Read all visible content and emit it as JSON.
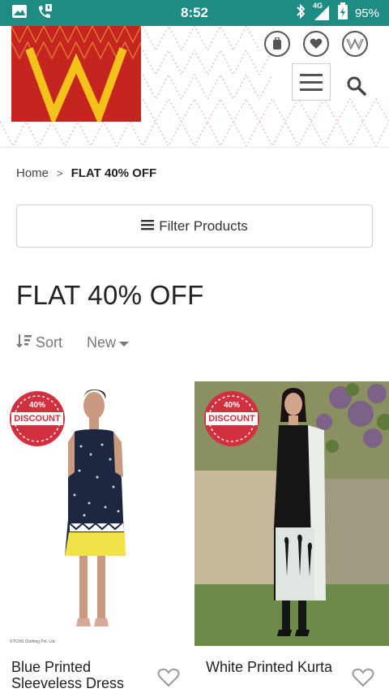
{
  "status_bar": {
    "time": "8:52",
    "network": "4G",
    "battery": "95%"
  },
  "header": {
    "logo_letter": "W",
    "brand_mark": "W"
  },
  "breadcrumb": {
    "home": "Home",
    "separator": ">",
    "current": "FLAT 40% OFF"
  },
  "filter": {
    "label": "Filter Products"
  },
  "page_title": "FLAT 40% OFF",
  "sort": {
    "label": "Sort",
    "new_label": "New"
  },
  "badge": {
    "percent": "40%",
    "text": "DISCOUNT"
  },
  "products": [
    {
      "name": "Blue Printed Sleeveless Dress",
      "copyright": "©TCNS Clothing Pvt. Ltd."
    },
    {
      "name": "White Printed Kurta"
    }
  ],
  "colors": {
    "status_bar": "#1e8c82",
    "logo_red": "#c4251e",
    "logo_yellow": "#f5c21b",
    "badge_red": "#d32f3f"
  }
}
